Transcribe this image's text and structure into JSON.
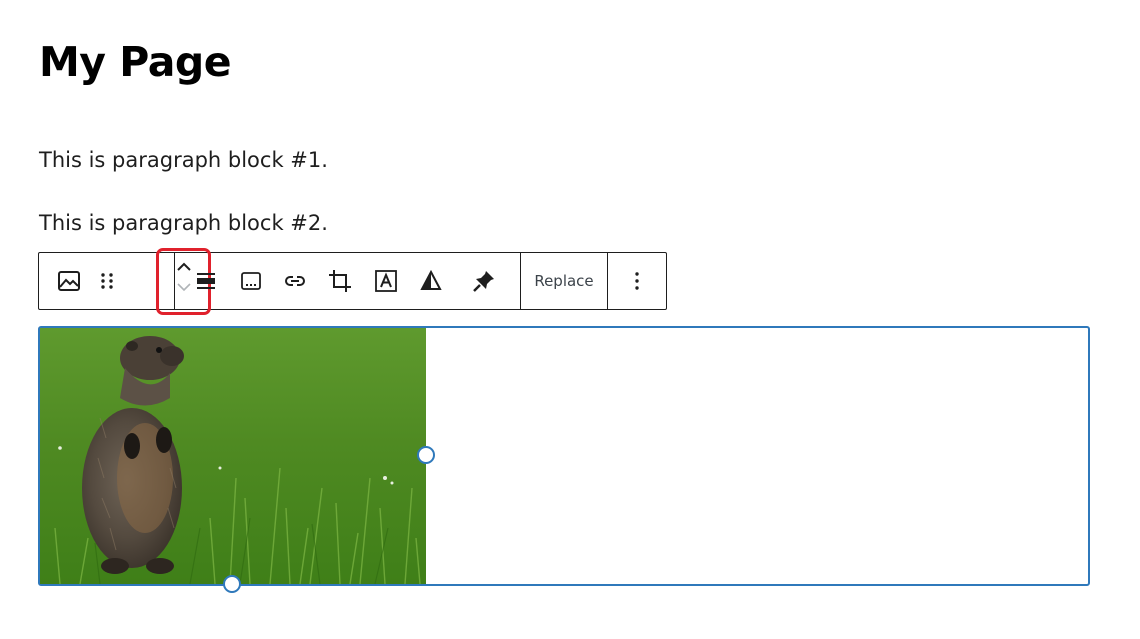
{
  "page": {
    "title": "My Page"
  },
  "paragraphs": [
    "This is paragraph block #1.",
    "This is paragraph block #2."
  ],
  "toolbar": {
    "items": [
      {
        "name": "image-block-icon"
      },
      {
        "name": "drag-handle-icon"
      },
      {
        "name": "move-up-icon",
        "note": ""
      },
      {
        "name": "move-down-icon"
      },
      {
        "name": "align-icon"
      },
      {
        "name": "caption-icon"
      },
      {
        "name": "link-icon"
      },
      {
        "name": "crop-icon"
      },
      {
        "name": "text-over-image-icon"
      },
      {
        "name": "duotone-filter-icon"
      },
      {
        "name": "pin-icon"
      }
    ],
    "replace_label": "Replace",
    "more_label": "⋮",
    "highlight_color": "#e0212c"
  },
  "image_block": {
    "border_color": "#2f79bb",
    "alt": "Groundhog standing upright in green grass"
  }
}
